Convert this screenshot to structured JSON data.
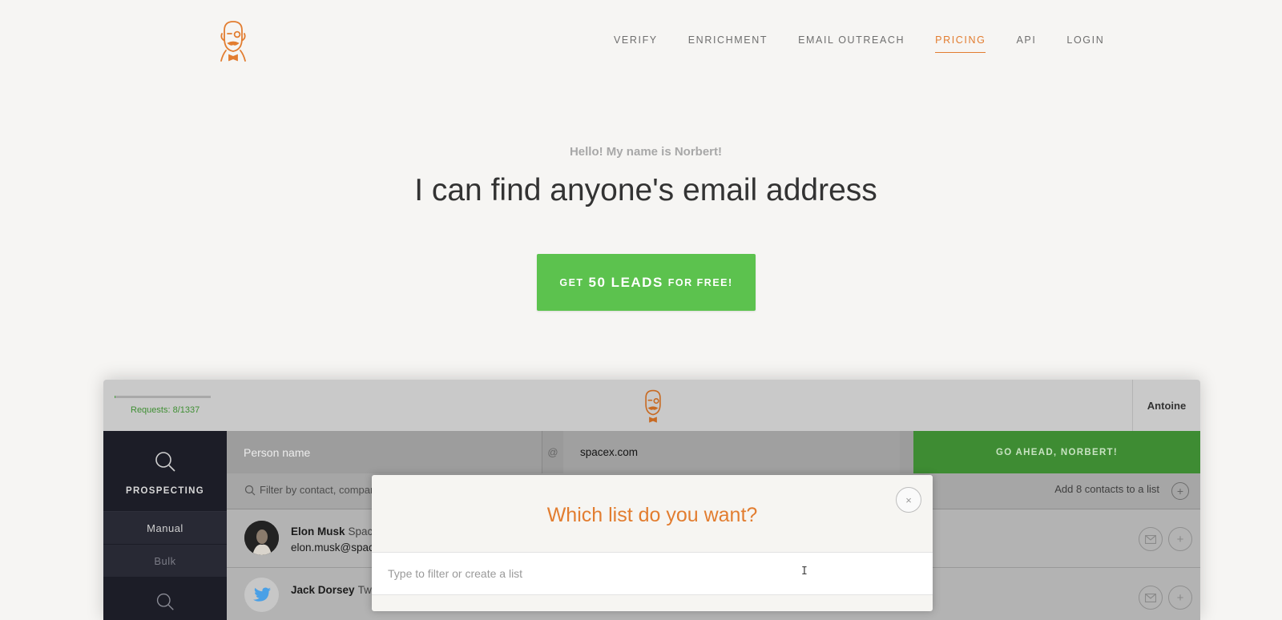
{
  "nav": {
    "items": [
      {
        "label": "VERIFY"
      },
      {
        "label": "ENRICHMENT"
      },
      {
        "label": "EMAIL OUTREACH"
      },
      {
        "label": "PRICING",
        "active": true
      },
      {
        "label": "API"
      },
      {
        "label": "LOGIN"
      }
    ]
  },
  "hero": {
    "greeting": "Hello! My name is Norbert!",
    "headline": "I can find anyone's email address",
    "cta_prefix": "GET",
    "cta_main": "50 LEADS",
    "cta_suffix": "FOR FREE!"
  },
  "app": {
    "requests_text": "Requests: 8/1337",
    "requests_fraction": 0.006,
    "user_name": "Antoine",
    "sidebar": {
      "section_label": "PROSPECTING",
      "items": [
        "Manual",
        "Bulk"
      ]
    },
    "search": {
      "person_placeholder": "Person name",
      "at_symbol": "@",
      "domain_value": "spacex.com",
      "go_button": "GO AHEAD, NORBERT!"
    },
    "filter": {
      "text": "Filter by contact, compar",
      "add_to_list": "Add 8 contacts to a list",
      "add_icon_glyph": "+"
    },
    "contacts": [
      {
        "name": "Elon Musk",
        "company": "Spac",
        "email": "elon.musk@spac"
      },
      {
        "name": "Jack Dorsey",
        "company": "Tw",
        "email": ""
      }
    ],
    "row_icons": {
      "mail": "mail-icon",
      "add": "+"
    }
  },
  "modal": {
    "title": "Which list do you want?",
    "close_glyph": "×",
    "input_placeholder": "Type to filter or create a list",
    "input_value": ""
  },
  "colors": {
    "accent": "#e27d30",
    "cta_green": "#5cc24e",
    "go_green": "#3e8c33",
    "background": "#f6f5f3",
    "sidebar_dark": "#1c1d27"
  }
}
